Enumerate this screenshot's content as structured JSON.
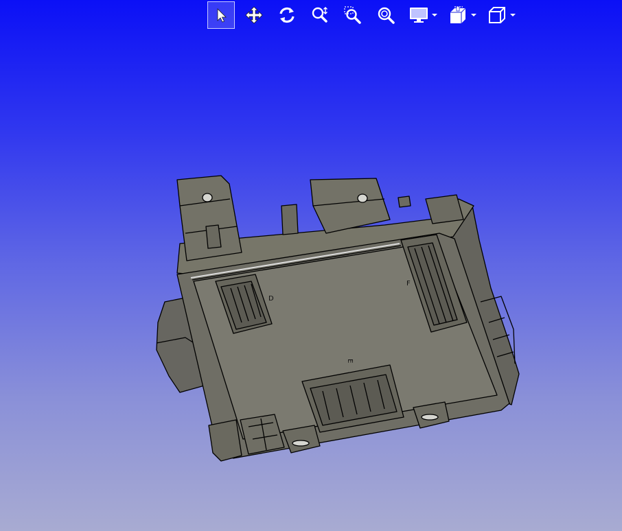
{
  "toolbar": {
    "buttons": [
      {
        "id": "select",
        "icon": "select-arrow-icon",
        "active": true
      },
      {
        "id": "pan",
        "icon": "pan-move-icon",
        "active": false
      },
      {
        "id": "rotate",
        "icon": "rotate-icon",
        "active": false
      },
      {
        "id": "zoom",
        "icon": "zoom-icon",
        "active": false
      },
      {
        "id": "zoom-window",
        "icon": "zoom-window-icon",
        "active": false
      },
      {
        "id": "zoom-fit",
        "icon": "zoom-fit-icon",
        "active": false
      },
      {
        "id": "display-mode",
        "icon": "monitor-icon",
        "dropdown": true
      },
      {
        "id": "section",
        "icon": "section-plane-icon",
        "dropdown": true
      },
      {
        "id": "view-orientation",
        "icon": "cube-view-icon",
        "dropdown": true
      }
    ]
  },
  "viewport": {
    "background_top": "#0b10f6",
    "background_bottom": "#a8abd2",
    "model_color": "#6e6d64",
    "edge_color": "#000000"
  },
  "model": {
    "connector_labels": {
      "d": "D",
      "e": "E",
      "f": "F"
    }
  }
}
